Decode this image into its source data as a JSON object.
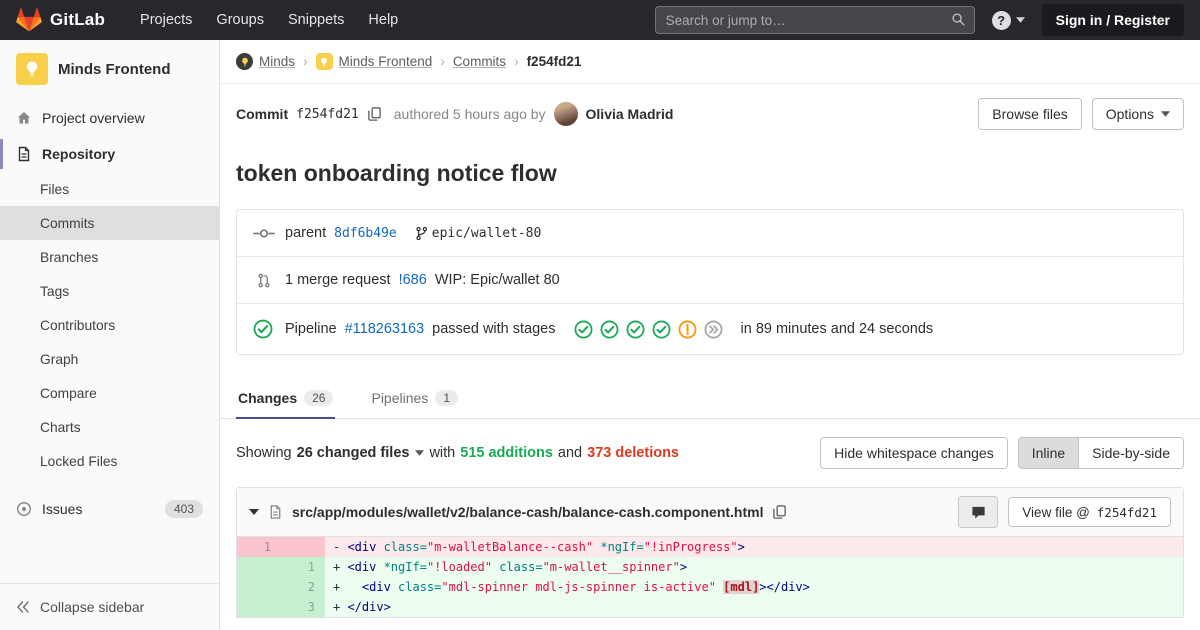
{
  "navbar": {
    "brand": "GitLab",
    "links": [
      "Projects",
      "Groups",
      "Snippets",
      "Help"
    ],
    "search_placeholder": "Search or jump to…",
    "help_icon": "?",
    "sign_in_label": "Sign in / Register"
  },
  "sidebar": {
    "project_name": "Minds Frontend",
    "overview_label": "Project overview",
    "repository_label": "Repository",
    "repository_subitems": [
      {
        "label": "Files",
        "active": false
      },
      {
        "label": "Commits",
        "active": true
      },
      {
        "label": "Branches",
        "active": false
      },
      {
        "label": "Tags",
        "active": false
      },
      {
        "label": "Contributors",
        "active": false
      },
      {
        "label": "Graph",
        "active": false
      },
      {
        "label": "Compare",
        "active": false
      },
      {
        "label": "Charts",
        "active": false
      },
      {
        "label": "Locked Files",
        "active": false
      }
    ],
    "issues_label": "Issues",
    "issues_count": "403",
    "collapse_label": "Collapse sidebar"
  },
  "breadcrumb": {
    "links": [
      {
        "label": "Minds",
        "avatar": "dark"
      },
      {
        "label": "Minds Frontend",
        "avatar": "yellow"
      },
      {
        "label": "Commits",
        "avatar": ""
      }
    ],
    "separator": "›",
    "current": "f254fd21"
  },
  "commit_bar": {
    "commit_label": "Commit",
    "sha": "f254fd21",
    "authored_text": "authored 5 hours ago by",
    "author_name": "Olivia Madrid",
    "browse_files_label": "Browse files",
    "options_label": "Options"
  },
  "commit": {
    "title": "token onboarding notice flow",
    "parent_label": "parent",
    "parent_sha": "8df6b49e",
    "branch_name": "epic/wallet-80",
    "merge_request_text": "1 merge request",
    "merge_request_ref": "!686",
    "merge_request_title": "WIP: Epic/wallet 80",
    "pipeline_label": "Pipeline",
    "pipeline_id": "#118263163",
    "pipeline_status_text": "passed with stages",
    "pipeline_stages": [
      "passed",
      "passed",
      "passed",
      "passed",
      "warning",
      "skipped"
    ],
    "pipeline_duration": "in 89 minutes and 24 seconds"
  },
  "tabs": [
    {
      "label": "Changes",
      "count": "26"
    },
    {
      "label": "Pipelines",
      "count": "1"
    }
  ],
  "diff_bar": {
    "showing_label": "Showing",
    "changed_files": "26 changed files",
    "with_label": "with",
    "additions": "515 additions",
    "and_label": "and",
    "deletions": "373 deletions",
    "hide_whitespace_label": "Hide whitespace changes",
    "inline_label": "Inline",
    "side_by_side_label": "Side-by-side"
  },
  "file_diff": {
    "path": "src/app/modules/wallet/v2/balance-cash/balance-cash.component.html",
    "view_file_label": "View file @",
    "view_file_sha": "f254fd21",
    "lines": [
      {
        "old": "1",
        "new": "",
        "type": "del",
        "sign": "-",
        "tokens": [
          [
            "<div ",
            "nt"
          ],
          [
            "class=",
            "na"
          ],
          [
            "\"m-walletBalance--cash\"",
            "s"
          ],
          [
            " ",
            ""
          ],
          [
            "*ngIf=",
            "na"
          ],
          [
            "\"!inProgress\"",
            "s"
          ],
          [
            ">",
            "nt"
          ]
        ]
      },
      {
        "old": "",
        "new": "1",
        "type": "add",
        "sign": "+",
        "tokens": [
          [
            "<div ",
            "nt"
          ],
          [
            "*ngIf=",
            "na"
          ],
          [
            "\"!loaded\"",
            "s"
          ],
          [
            " ",
            ""
          ],
          [
            "class=",
            "na"
          ],
          [
            "\"m-wallet__spinner\"",
            "s"
          ],
          [
            ">",
            "nt"
          ]
        ]
      },
      {
        "old": "",
        "new": "2",
        "type": "add",
        "sign": "+",
        "tokens": [
          [
            "  ",
            ""
          ],
          [
            "<div ",
            "nt"
          ],
          [
            "class=",
            "na"
          ],
          [
            "\"mdl-spinner mdl-js-spinner is-active\"",
            "s"
          ],
          [
            " ",
            ""
          ],
          [
            "[mdl]",
            "err"
          ],
          [
            ">",
            "nt"
          ],
          [
            "</div>",
            "nt"
          ]
        ]
      },
      {
        "old": "",
        "new": "3",
        "type": "add",
        "sign": "+",
        "tokens": [
          [
            "</div>",
            "nt"
          ]
        ]
      }
    ]
  },
  "colors": {
    "navbar_bg": "#28272e",
    "link_blue": "#1068bf",
    "addition_green": "#1aaa55",
    "deletion_red": "#db3b21",
    "warning_orange": "#fc9403",
    "active_tab_underline": "#4b4b8d",
    "project_avatar_yellow": "#f8d04b"
  }
}
